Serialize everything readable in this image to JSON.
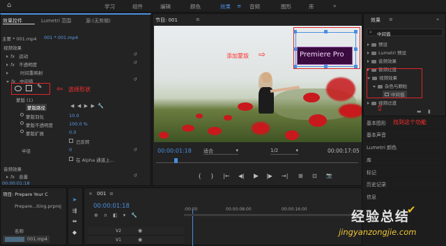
{
  "topbar": {
    "home_icon": "home-icon",
    "workspaces": [
      "学习",
      "组件",
      "编辑",
      "颜色",
      "效果",
      "音频",
      "图形",
      "库"
    ],
    "active": "效果",
    "menu_icon": "≡",
    "more": "»"
  },
  "left_panel": {
    "tabs": [
      "效果控件",
      "Lumetri 范围",
      "源:(无剪辑)"
    ],
    "clip_master": "主要 * 001.mp4",
    "clip_seq": "001 * 001.mp4",
    "section": "视频效果",
    "rows": [
      {
        "label": "运动",
        "fx": true
      },
      {
        "label": "不透明度",
        "fx": true
      },
      {
        "label": "时间重映射",
        "fx": false
      },
      {
        "label": "中间值",
        "fx": true
      }
    ],
    "mask_label": "蒙版 (1)",
    "mask_path": "蒙版路径",
    "mask_props": [
      {
        "label": "蒙版羽化",
        "value": "10.0"
      },
      {
        "label": "蒙版不透明度",
        "value": "100.0 %"
      },
      {
        "label": "蒙版扩展",
        "value": "0.0"
      }
    ],
    "inverted": "已反转",
    "radius_label": "半径",
    "radius_value": "0",
    "alpha": "在 Alpha 通道上...",
    "audio_section": "音频效果",
    "volume": "音量",
    "timecode": "00:00:01:18"
  },
  "annotations": {
    "choose_shape": "选择形状",
    "add_mask": "添加蒙版",
    "find_effect": "找到这个功能"
  },
  "program": {
    "title": "节目: 001",
    "overlay_text": "Premiere Pro",
    "timecode": "00:00:01:18",
    "fit": "适合",
    "quality": "1/2",
    "duration": "00:00:17:05",
    "controls": [
      "{",
      "}",
      "|←",
      "◀|",
      "▶",
      "|▶",
      "→|",
      "⊞",
      "⊡",
      "📷"
    ]
  },
  "effects_panel": {
    "title": "效果",
    "search_value": "中间值",
    "tree": [
      {
        "label": "预设",
        "level": 0
      },
      {
        "label": "Lumetri 预设",
        "level": 0
      },
      {
        "label": "音频效果",
        "level": 0
      },
      {
        "label": "音频过渡",
        "level": 0
      },
      {
        "label": "视频效果",
        "level": 0,
        "open": true
      },
      {
        "label": "杂色与颗粒",
        "level": 1,
        "open": true
      },
      {
        "label": "中间值",
        "level": 2
      },
      {
        "label": "视频过渡",
        "level": 0
      }
    ],
    "menu": [
      "基本图形",
      "基本声音",
      "Lumetri 颜色",
      "库",
      "标记",
      "历史记录",
      "信息"
    ]
  },
  "project_panel": {
    "title": "项目: Prepare Your C",
    "file": "Prepare...iting.prproj",
    "name_col": "名称",
    "item": "001.mp4"
  },
  "timeline": {
    "seq_tab": "001",
    "timecode": "00:00:01:18",
    "ruler": [
      ":00:00",
      "00:00:08:00",
      "00:00:16:00"
    ],
    "tracks": [
      "V2",
      "V1"
    ]
  },
  "watermark": {
    "brand": "经验总结",
    "url": "jingyanzongjie.com"
  },
  "colors": {
    "accent": "#4a8fe0",
    "annotation": "#e0262a",
    "overlay_bg": "#3a0b3f"
  }
}
